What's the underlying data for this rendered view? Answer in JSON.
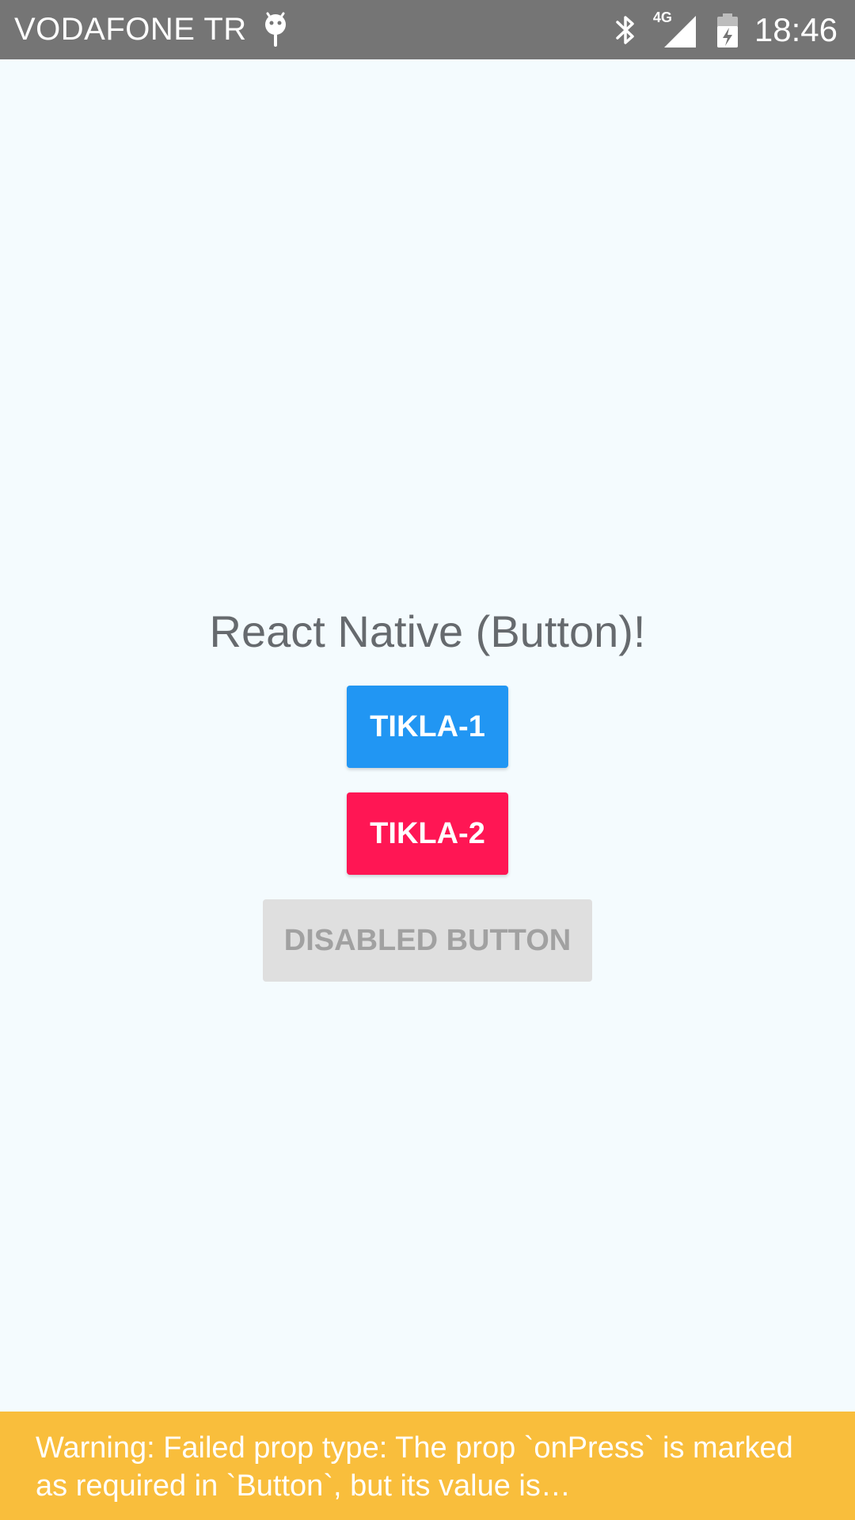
{
  "status_bar": {
    "carrier": "VODAFONE TR",
    "network_type": "4G",
    "time": "18:46",
    "icons": [
      "debug-bug-icon",
      "bluetooth-icon",
      "cell-signal-icon",
      "battery-charging-icon"
    ]
  },
  "main": {
    "title": "React Native (Button)!",
    "buttons": [
      {
        "label": "TIKLA-1",
        "color": "#2196F3",
        "enabled": true
      },
      {
        "label": "TIKLA-2",
        "color": "#FF1654",
        "enabled": true
      },
      {
        "label": "DISABLED BUTTON",
        "color": "#DFDFDF",
        "enabled": false
      }
    ]
  },
  "warning_banner": {
    "text": "Warning: Failed prop type: The prop `onPress` is marked as required in `Button`, but its value is…",
    "color": "#F9BE3C"
  },
  "colors": {
    "status_bar": "#757575",
    "background": "#F4FBFE",
    "title_text": "#666A6E"
  }
}
